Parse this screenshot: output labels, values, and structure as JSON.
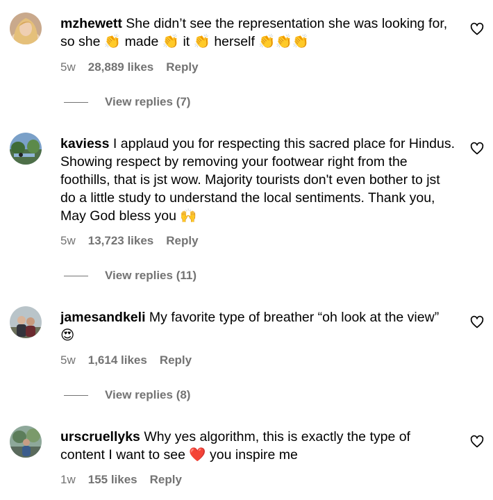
{
  "comments": [
    {
      "username": "mzhewett",
      "text": "She didn’t see the representation she was looking for, so she 👏 made 👏 it 👏 herself 👏👏👏",
      "time": "5w",
      "likes": "28,889 likes",
      "reply": "Reply",
      "view_replies": "View replies (7)"
    },
    {
      "username": "kaviess",
      "text": "I applaud you for respecting this sacred place for Hindus. Showing respect by removing your footwear right from the foothills, that is jst wow. Majority tourists don't even bother to jst do a little study to understand the local sentiments. Thank you, May God bless you 🙌",
      "time": "5w",
      "likes": "13,723 likes",
      "reply": "Reply",
      "view_replies": "View replies (11)"
    },
    {
      "username": "jamesandkeli",
      "text": "My favorite type of breather “oh look at the view” 😍",
      "time": "5w",
      "likes": "1,614 likes",
      "reply": "Reply",
      "view_replies": "View replies (8)"
    },
    {
      "username": "urscruellyks",
      "text": "Why yes algorithm, this is exactly the type of content I want to see ❤️ you inspire me",
      "time": "1w",
      "likes": "155 likes",
      "reply": "Reply"
    }
  ],
  "icons": {
    "like": "heart-outline-icon"
  },
  "colors": {
    "secondary_text": "#737373",
    "primary_text": "#000000",
    "background": "#ffffff"
  }
}
